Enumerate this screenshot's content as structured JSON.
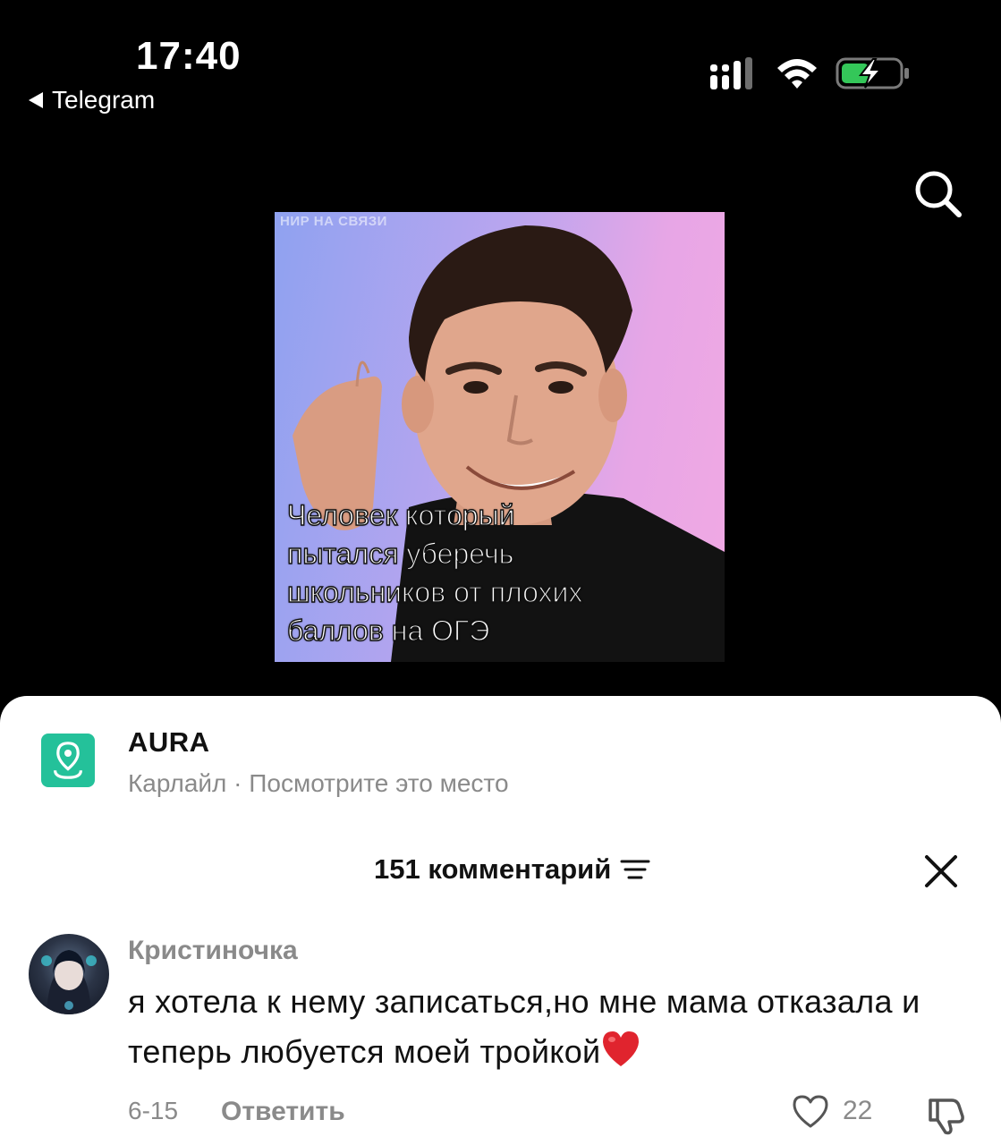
{
  "status_bar": {
    "time": "17:40",
    "back_app_label": "Telegram",
    "signal_icon": "cellular-signal-icon",
    "wifi_icon": "wifi-icon",
    "battery_icon": "battery-charging-icon",
    "battery_color": "#34c759"
  },
  "header": {
    "search_icon": "search-icon"
  },
  "video": {
    "watermark": "НИР НА СВЯЗИ",
    "caption": "Человек который\nпытался уберечь\nшкольников от плохих\nбаллов на ОГЭ"
  },
  "place": {
    "icon": "location-pin-icon",
    "title": "AURA",
    "subtitle": "Карлайл · Посмотрите это место",
    "accent_color": "#24c19a"
  },
  "comments": {
    "header": "151 комментарий",
    "filter_icon": "filter-lines-icon",
    "close_icon": "close-icon",
    "items": [
      {
        "author": "Кристиночка",
        "text": "я хотела к нему записаться,но мне мама отказала и теперь любуется моей тройкой",
        "emoji": "red-heart-emoji",
        "date": "6-15",
        "reply_label": "Ответить",
        "likes": "22",
        "like_icon": "heart-outline-icon",
        "dislike_icon": "thumbs-down-icon"
      }
    ]
  }
}
